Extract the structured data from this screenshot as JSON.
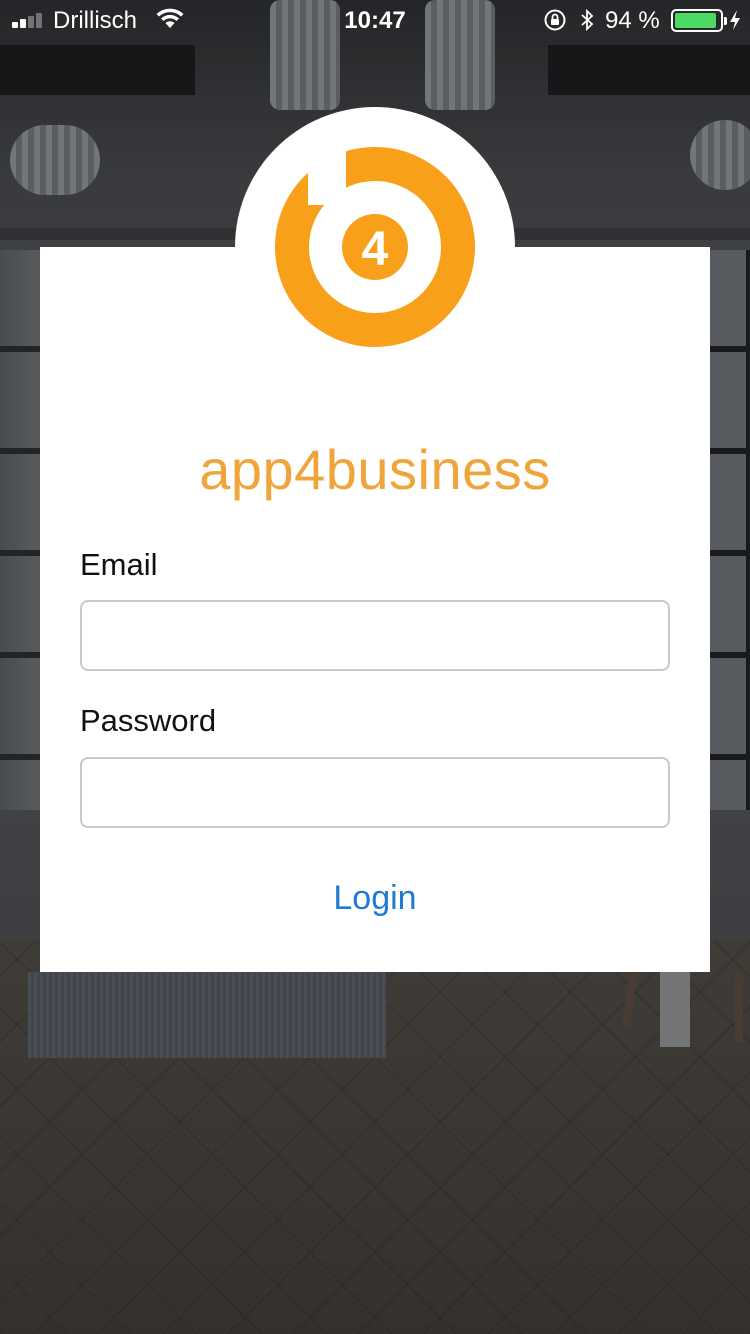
{
  "status_bar": {
    "carrier": "Drillisch",
    "time": "10:47",
    "battery_percent_text": "94 %",
    "battery_level": 0.94,
    "icons": [
      "signal-icon",
      "wifi-icon",
      "orientation-lock-icon",
      "bluetooth-icon",
      "battery-icon",
      "charging-icon"
    ]
  },
  "brand": {
    "logo_text": "4",
    "logo_icon": "b4-logo",
    "name": "app4business",
    "color": "#f0a53a",
    "logo_color": "#f9a01b"
  },
  "form": {
    "email_label": "Email",
    "email_value": "",
    "email_placeholder": "",
    "password_label": "Password",
    "password_value": "",
    "password_placeholder": "",
    "login_label": "Login",
    "login_color": "#1f7bd1"
  }
}
